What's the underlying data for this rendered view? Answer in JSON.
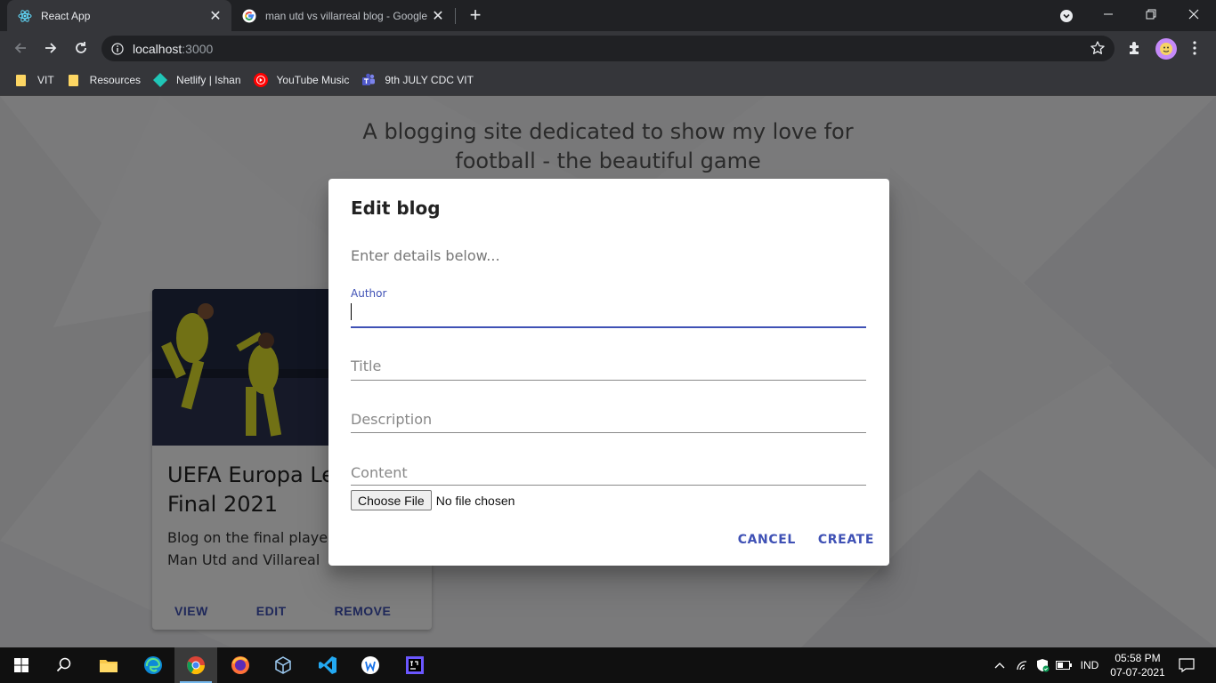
{
  "browser": {
    "tabs": [
      {
        "title": "React App",
        "active": true
      },
      {
        "title": "man utd vs villarreal blog - Google S",
        "active": false
      }
    ],
    "address": {
      "host": "localhost",
      "port": ":3000"
    },
    "bookmarks": [
      {
        "label": "VIT",
        "icon": "folder-icon"
      },
      {
        "label": "Resources",
        "icon": "folder-icon"
      },
      {
        "label": "Netlify | Ishan",
        "icon": "netlify-icon"
      },
      {
        "label": "YouTube Music",
        "icon": "youtube-music-icon"
      },
      {
        "label": "9th JULY CDC VIT",
        "icon": "teams-icon"
      }
    ]
  },
  "page": {
    "tagline": "A blogging site dedicated to show my love for football - the beautiful game",
    "card": {
      "title": "UEFA Europa League Final 2021",
      "description": "Blog on the final played between Man Utd and Villareal",
      "actions": {
        "view": "VIEW",
        "edit": "EDIT",
        "remove": "REMOVE"
      }
    }
  },
  "dialog": {
    "title": "Edit blog",
    "text": "Enter details below...",
    "fields": {
      "author": {
        "label": "Author",
        "value": ""
      },
      "title": {
        "label": "Title",
        "value": ""
      },
      "description": {
        "label": "Description",
        "value": ""
      },
      "content": {
        "label": "Content",
        "value": ""
      }
    },
    "file": {
      "button": "Choose File",
      "status": "No file chosen"
    },
    "actions": {
      "cancel": "CANCEL",
      "create": "CREATE"
    }
  },
  "taskbar": {
    "language": "IND",
    "time": "05:58 PM",
    "date": "07-07-2021"
  },
  "colors": {
    "accent": "#3f51b5",
    "chrome_bg": "#202124",
    "chrome_toolbar": "#35363a"
  }
}
